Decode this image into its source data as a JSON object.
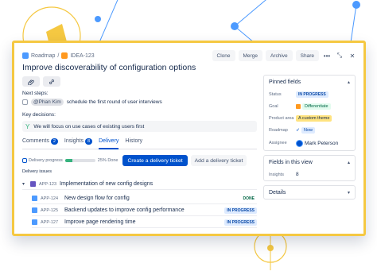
{
  "colors": {
    "accent": "#0052cc",
    "card_border": "#f5c842",
    "done": "#36b37e",
    "deco_ring": "#f5c842",
    "deco_node": "#4c9aff"
  },
  "breadcrumb": {
    "project": "Roadmap",
    "separator": "/",
    "issue_key": "IDEA-123"
  },
  "header_actions": {
    "clone": "Clone",
    "merge": "Merge",
    "archive": "Archive",
    "share": "Share",
    "more_icon": "•••",
    "minimize_icon": "⤡",
    "close_icon": "✕"
  },
  "title": "Improve discoverability of configuration options",
  "toolbar": {
    "attach_icon": "paperclip-icon",
    "link_icon": "link-icon"
  },
  "next_steps": {
    "label": "Next steps:",
    "mention": "@Phan Kim",
    "text": "schedule the first round of user interviews"
  },
  "key_decisions": {
    "label": "Key decisions:",
    "text": "We will focus on use cases of existing users first"
  },
  "tabs": [
    {
      "label": "Comments",
      "badge": "2"
    },
    {
      "label": "Insights",
      "badge": "8"
    },
    {
      "label": "Delivery",
      "badge": ""
    },
    {
      "label": "History",
      "badge": ""
    }
  ],
  "delivery": {
    "progress_label": "Delivery progress",
    "progress_fraction": 0.25,
    "progress_text": "25% Done",
    "create_button": "Create a delivery ticket",
    "add_button": "Add a delivery ticket",
    "issues_label": "Delivery issues",
    "parent": {
      "key": "APP-123",
      "summary": "Implementation of new config designs"
    },
    "children": [
      {
        "key": "APP-124",
        "summary": "New design flow for config",
        "status": "DONE"
      },
      {
        "key": "APP-125",
        "summary": "Backend updates to improve config performance",
        "status": "IN PROGRESS"
      },
      {
        "key": "APP-127",
        "summary": "Improve page rendering time",
        "status": "IN PROGRESS"
      }
    ]
  },
  "pinned_fields": {
    "title": "Pinned fields",
    "rows": [
      {
        "label": "Status",
        "value": "IN PROGRESS"
      },
      {
        "label": "Goal",
        "value": "Differentiate"
      },
      {
        "label": "Product area",
        "value": "A custom theme"
      },
      {
        "label": "Roadmap",
        "value": "Now"
      },
      {
        "label": "Assignee",
        "value": "Mark Peterson"
      }
    ]
  },
  "fields_in_view": {
    "title": "Fields in this view",
    "rows": [
      {
        "label": "Insights",
        "value": "8"
      }
    ]
  },
  "details": {
    "title": "Details"
  }
}
